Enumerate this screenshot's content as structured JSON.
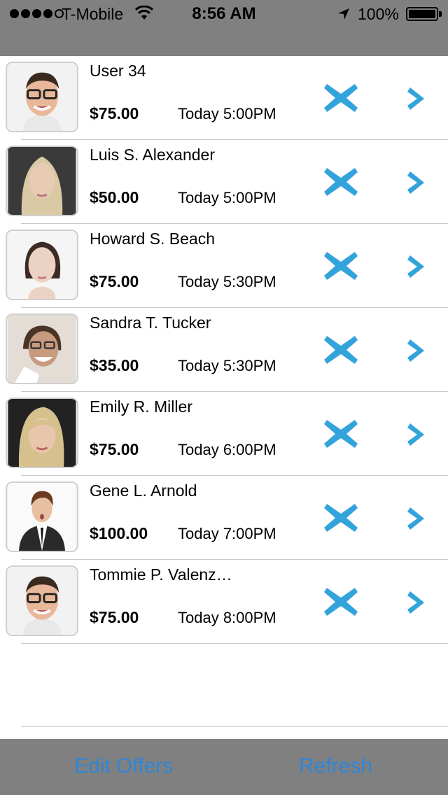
{
  "status_bar": {
    "carrier": "T-Mobile",
    "time": "8:56 AM",
    "battery": "100%",
    "signal_icon": "signal-dots-icon",
    "wifi_icon": "wifi-icon",
    "location_icon": "location-arrow-icon",
    "battery_icon": "battery-icon"
  },
  "offers": [
    {
      "name": "User 34",
      "amount": "$75.00",
      "time": "Today 5:00PM",
      "avatar": "man-glasses"
    },
    {
      "name": "Luis S. Alexander",
      "amount": "$50.00",
      "time": "Today 5:00PM",
      "avatar": "woman-blonde"
    },
    {
      "name": "Howard S. Beach",
      "amount": "$75.00",
      "time": "Today 5:30PM",
      "avatar": "woman-dark-hair"
    },
    {
      "name": "Sandra T. Tucker",
      "amount": "$35.00",
      "time": "Today 5:30PM",
      "avatar": "woman-smiling-glasses"
    },
    {
      "name": "Emily R. Miller",
      "amount": "$75.00",
      "time": "Today 6:00PM",
      "avatar": "woman-blonde-bangs"
    },
    {
      "name": "Gene L. Arnold",
      "amount": "$100.00",
      "time": "Today 7:00PM",
      "avatar": "man-suit"
    },
    {
      "name": "Tommie P. Valenz…",
      "amount": "$75.00",
      "time": "Today 8:00PM",
      "avatar": "man-glasses"
    }
  ],
  "toolbar": {
    "edit_label": "Edit Offers",
    "refresh_label": "Refresh"
  },
  "colors": {
    "accent": "#2f86d8",
    "action_blue": "#33a3dc",
    "bar_gray": "#808080"
  }
}
